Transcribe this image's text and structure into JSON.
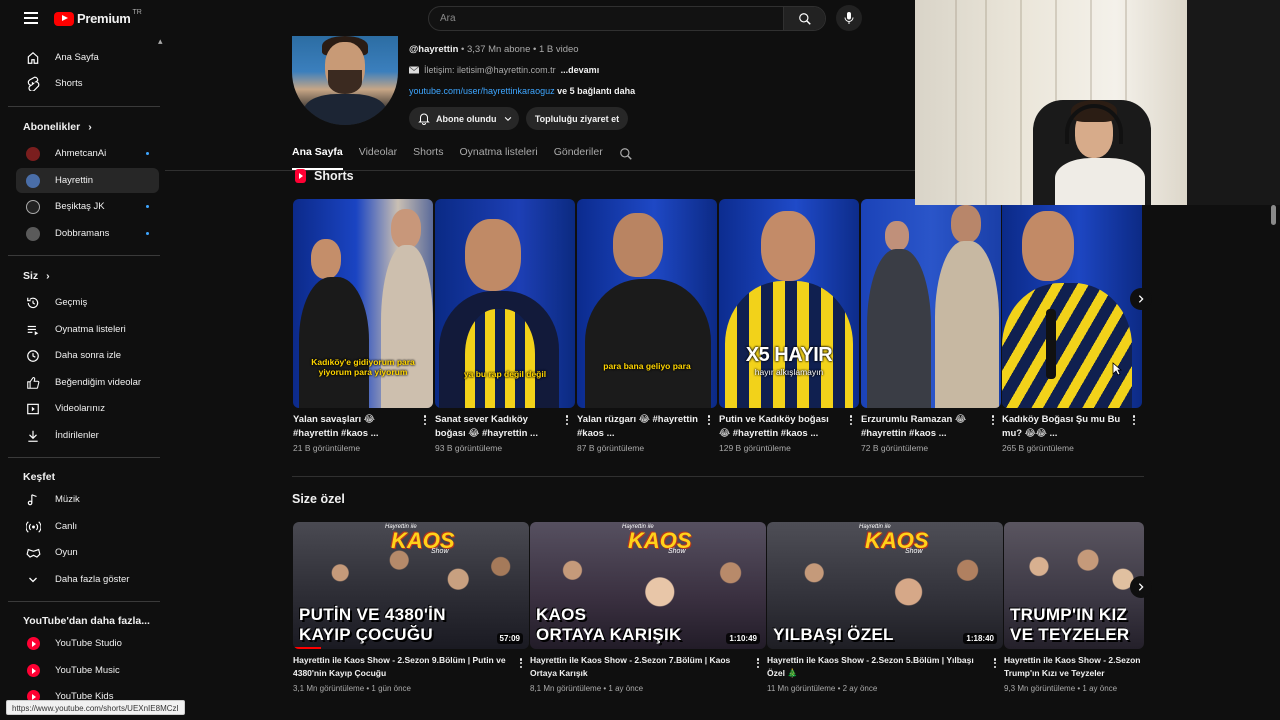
{
  "topbar": {
    "logo_text": "Premium",
    "logo_region": "TR",
    "search_placeholder": "Ara"
  },
  "sidebar": {
    "main": [
      {
        "label": "Ana Sayfa",
        "icon": "home-icon"
      },
      {
        "label": "Shorts",
        "icon": "shorts-icon"
      }
    ],
    "subscriptions_header": "Abonelikler",
    "subscriptions": [
      {
        "label": "AhmetcanAi",
        "avatar_color": "#7a1e1e",
        "new": true
      },
      {
        "label": "Hayrettin",
        "avatar_color": "#4a6ea8",
        "new": false,
        "active": true
      },
      {
        "label": "Beşiktaş JK",
        "avatar_color": "#222222",
        "new": true
      },
      {
        "label": "Dobbramans",
        "avatar_color": "#5a5a5a",
        "new": true
      }
    ],
    "you_header": "Siz",
    "you": [
      {
        "label": "Geçmiş",
        "icon": "history-icon"
      },
      {
        "label": "Oynatma listeleri",
        "icon": "playlist-icon"
      },
      {
        "label": "Daha sonra izle",
        "icon": "clock-icon"
      },
      {
        "label": "Beğendiğim videolar",
        "icon": "thumbs-up-icon"
      },
      {
        "label": "Videolarınız",
        "icon": "your-videos-icon"
      },
      {
        "label": "İndirilenler",
        "icon": "download-icon"
      }
    ],
    "explore_header": "Keşfet",
    "explore": [
      {
        "label": "Müzik",
        "icon": "music-icon"
      },
      {
        "label": "Canlı",
        "icon": "live-icon"
      },
      {
        "label": "Oyun",
        "icon": "gaming-icon"
      },
      {
        "label": "Daha fazla göster",
        "icon": "chevron-down-icon"
      }
    ],
    "more_header": "YouTube'dan daha fazla...",
    "more": [
      {
        "label": "YouTube Studio"
      },
      {
        "label": "YouTube Music"
      },
      {
        "label": "YouTube Kids"
      }
    ]
  },
  "channel": {
    "handle": "@hayrettin",
    "stats": " • 3,37 Mn abone • 1 B video",
    "contact": "İletişim: iletisim@hayrettin.com.tr",
    "contact_more": "...devamı",
    "link": "youtube.com/user/hayrettinkaraoguz",
    "link_more": "ve 5 bağlantı daha",
    "subscribe_label": "Abone olundu",
    "community_label": "Topluluğu ziyaret et"
  },
  "tabs": [
    "Ana Sayfa",
    "Videolar",
    "Shorts",
    "Oynatma listeleri",
    "Gönderiler"
  ],
  "shorts": {
    "header": "Shorts",
    "items": [
      {
        "title": "Yalan savaşları 😂 #hayrettin #kaos ...",
        "views": "21 B görüntüleme",
        "caption": "Kadıköy'e gidiyorum para yiyorum para yiyorum",
        "big": false
      },
      {
        "title": "Sanat sever Kadıköy boğası 😂 #hayrettin ...",
        "views": "93 B görüntüleme",
        "caption": "ya bu rap değil değil",
        "big": false
      },
      {
        "title": "Yalan rüzgarı 😂 #hayrettin #kaos ...",
        "views": "87 B görüntüleme",
        "caption": "para bana geliyo para",
        "big": false
      },
      {
        "title": "Putin ve Kadıköy boğası 😂 #hayrettin #kaos ...",
        "views": "129 B görüntüleme",
        "caption": "X5 HAYIR",
        "caption_small": "hayır alkışlamayın",
        "big": true
      },
      {
        "title": "Erzurumlu Ramazan 😂 #hayrettin #kaos ...",
        "views": "72 B görüntüleme",
        "caption": "",
        "big": false
      },
      {
        "title": "Kadıköy Boğası Şu mu Bu mu? 😂😂 ...",
        "views": "265 B görüntüleme",
        "caption": "",
        "big": false
      }
    ]
  },
  "for_you": {
    "header": "Size özel",
    "kaos_word": "KAOS",
    "kaos_sub": "Hayrettin ile",
    "kaos_show": "Show",
    "items": [
      {
        "title": "Hayrettin ile Kaos Show - 2.Sezon 9.Bölüm | Putin ve 4380'nin Kayıp Çocuğu",
        "views": "3,1 Mn görüntüleme",
        "age": "1 gün önce",
        "duration": "57:09",
        "thumb_text_1": "PUTİN VE 4380'İN",
        "thumb_text_2": "KAYIP ÇOCUĞU",
        "progress": 0.12
      },
      {
        "title": "Hayrettin ile Kaos Show - 2.Sezon 7.Bölüm | Kaos Ortaya Karışık",
        "views": "8,1 Mn görüntüleme",
        "age": "1 ay önce",
        "duration": "1:10:49",
        "thumb_text_1": "KAOS",
        "thumb_text_2": "ORTAYA KARIŞIK",
        "progress": 0
      },
      {
        "title": "Hayrettin ile Kaos Show - 2.Sezon 5.Bölüm | Yılbaşı Özel 🎄",
        "views": "11 Mn görüntüleme",
        "age": "2 ay önce",
        "duration": "1:18:40",
        "thumb_text_1": "",
        "thumb_text_2": "YILBAŞI ÖZEL",
        "progress": 0
      },
      {
        "title": "Hayrettin ile Kaos Show - 2.Sezon Trump'ın Kızı ve Teyzeler",
        "views": "9,3 Mn görüntüleme",
        "age": "1 ay önce",
        "duration": "",
        "thumb_text_1": "TRUMP'IN KIZ",
        "thumb_text_2": "VE TEYZELER",
        "progress": 0
      }
    ]
  },
  "status_url": "https://www.youtube.com/shorts/UEXnIE8MCzI",
  "colors": {
    "accent": "#ff0000",
    "link": "#3ea6ff",
    "background": "#0f0f0f"
  }
}
